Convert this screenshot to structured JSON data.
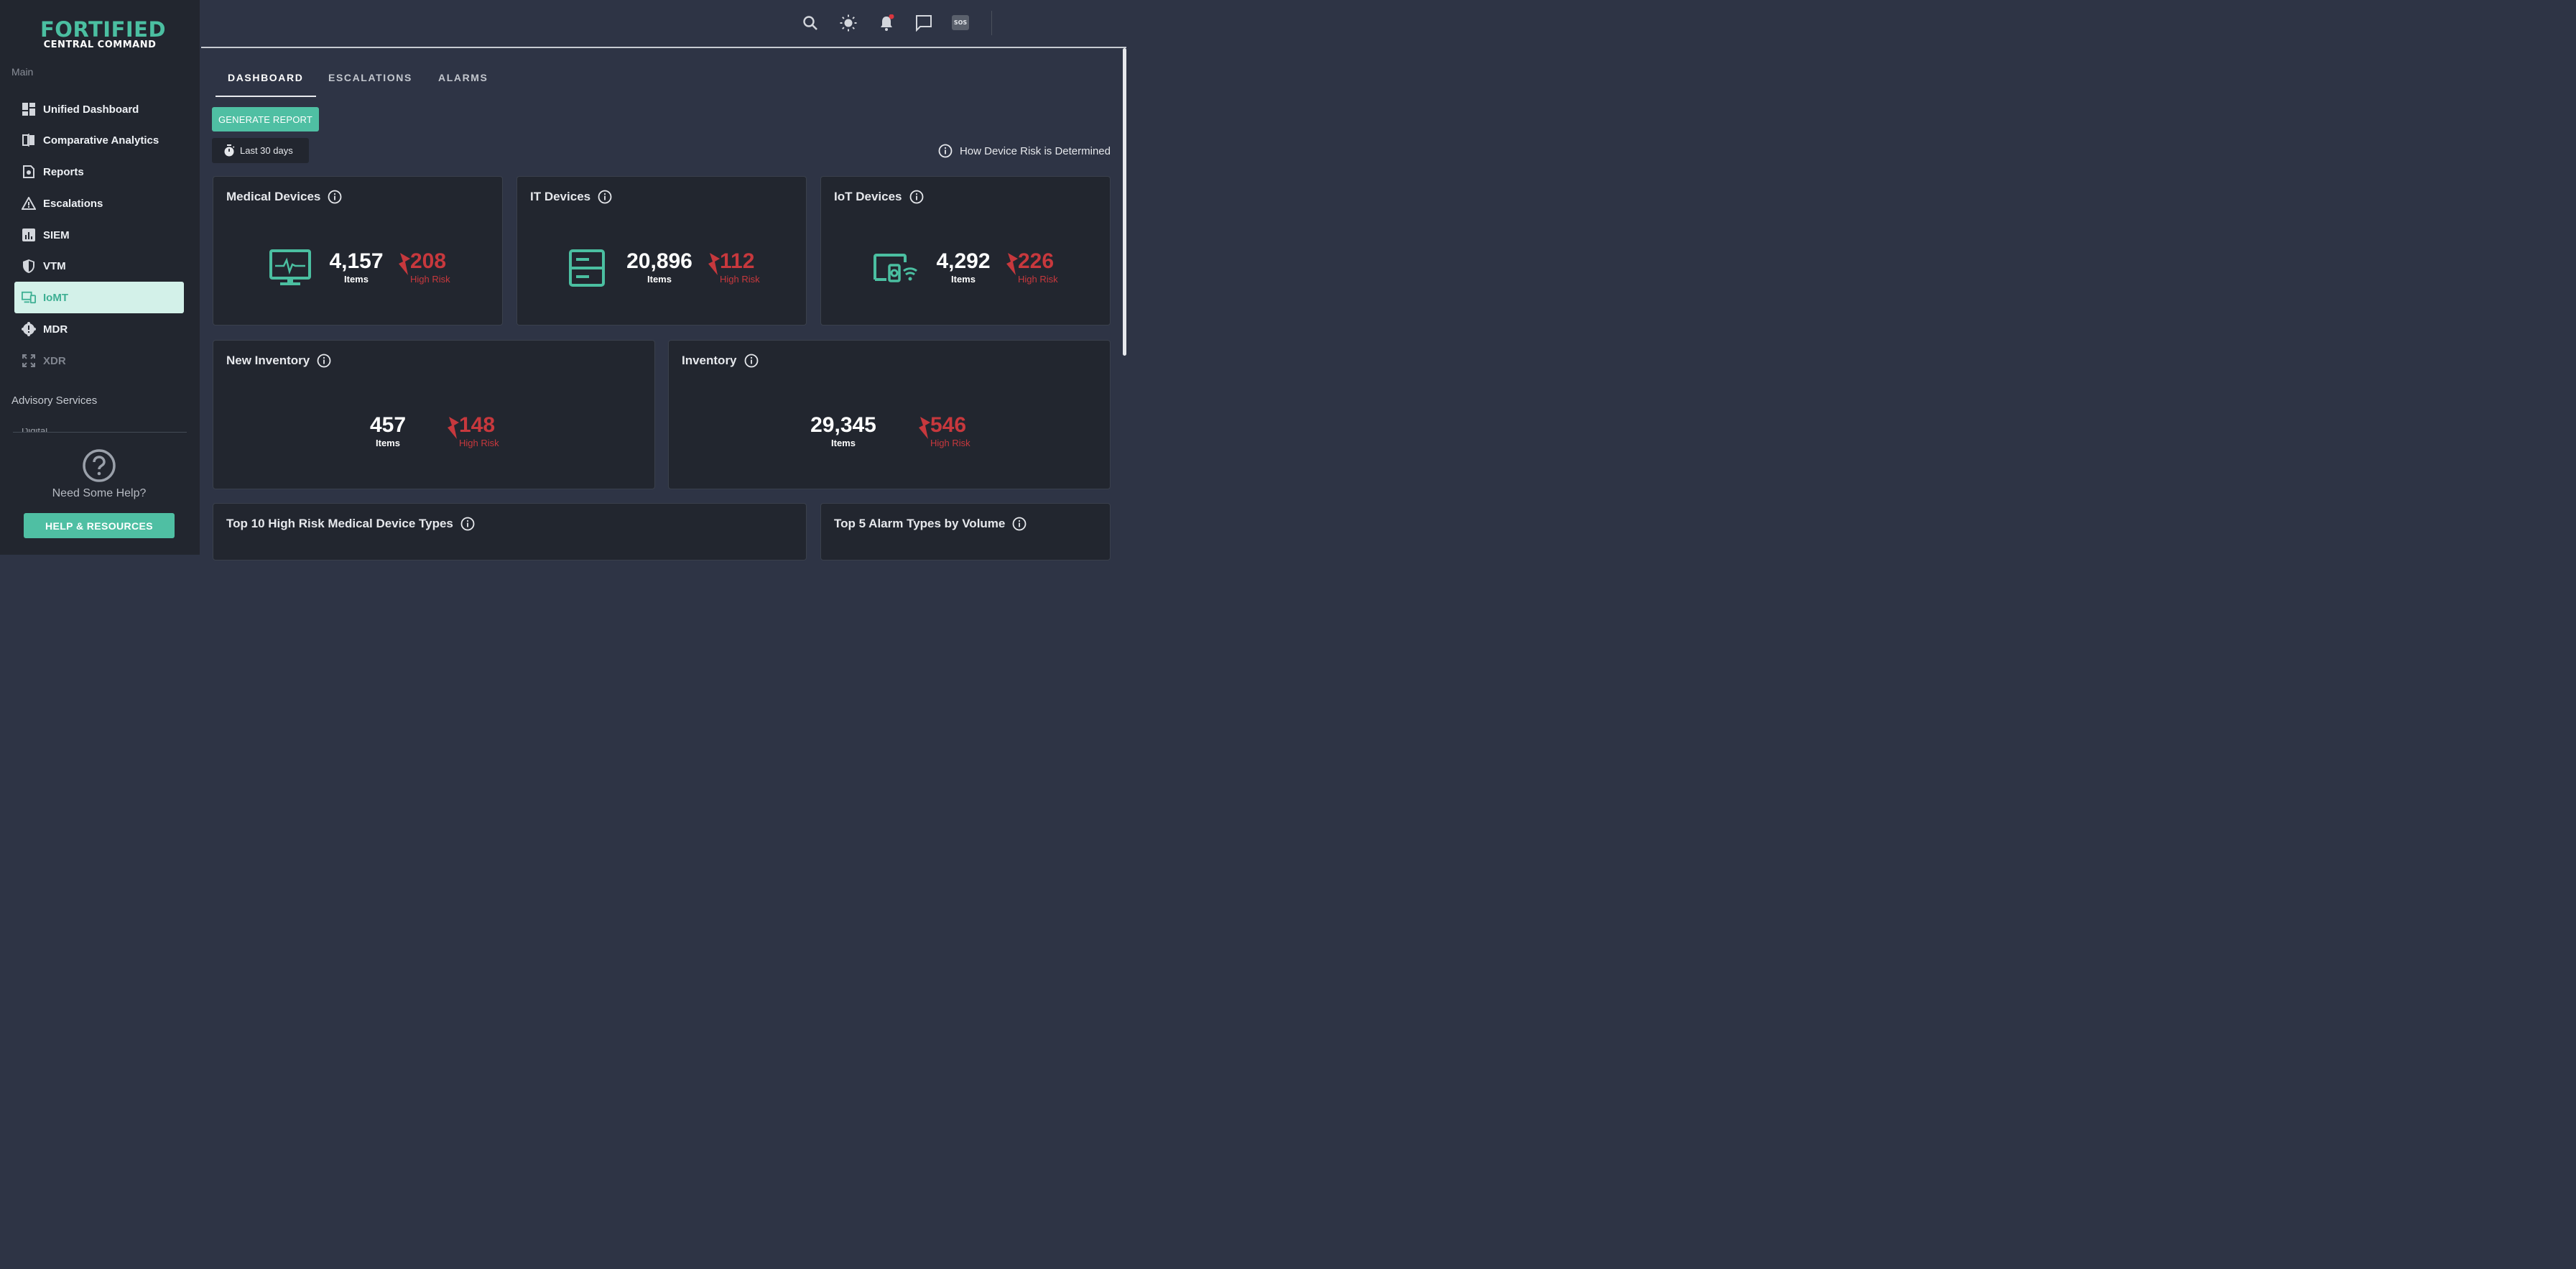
{
  "brand": {
    "line1": "FORTIFIED",
    "line2": "CENTRAL COMMAND"
  },
  "sidebar": {
    "section_main": "Main",
    "items": [
      {
        "label": "Unified Dashboard",
        "icon": "dashboard-grid-icon"
      },
      {
        "label": "Comparative Analytics",
        "icon": "compare-icon"
      },
      {
        "label": "Reports",
        "icon": "report-icon"
      },
      {
        "label": "Escalations",
        "icon": "warning-triangle-icon"
      },
      {
        "label": "SIEM",
        "icon": "bar-chart-icon"
      },
      {
        "label": "VTM",
        "icon": "shield-icon"
      },
      {
        "label": "IoMT",
        "icon": "devices-icon",
        "active": true
      },
      {
        "label": "MDR",
        "icon": "gear-badge-icon"
      },
      {
        "label": "XDR",
        "icon": "expand-icon",
        "disabled": true
      }
    ],
    "section_advisory": "Advisory Services",
    "advisory_partial": "Digital",
    "help_text": "Need Some Help?",
    "help_button": "HELP & RESOURCES"
  },
  "topbar": {
    "icons": [
      "search-icon",
      "brightness-icon",
      "bell-icon",
      "chat-icon",
      "sos-icon"
    ],
    "sos_label": "SOS"
  },
  "tabs": [
    {
      "label": "DASHBOARD",
      "active": true
    },
    {
      "label": "ESCALATIONS"
    },
    {
      "label": "ALARMS"
    }
  ],
  "actions": {
    "generate_report": "GENERATE REPORT",
    "date_filter": "Last 30 days",
    "risk_info": "How Device Risk is Determined"
  },
  "cards": {
    "medical": {
      "title": "Medical Devices",
      "items": "4,157",
      "items_label": "Items",
      "high_risk": "208",
      "high_risk_label": "High Risk"
    },
    "it": {
      "title": "IT Devices",
      "items": "20,896",
      "items_label": "Items",
      "high_risk": "112",
      "high_risk_label": "High Risk"
    },
    "iot": {
      "title": "IoT Devices",
      "items": "4,292",
      "items_label": "Items",
      "high_risk": "226",
      "high_risk_label": "High Risk"
    },
    "new_inventory": {
      "title": "New Inventory",
      "items": "457",
      "items_label": "Items",
      "high_risk": "148",
      "high_risk_label": "High Risk"
    },
    "inventory": {
      "title": "Inventory",
      "items": "29,345",
      "items_label": "Items",
      "high_risk": "546",
      "high_risk_label": "High Risk"
    },
    "top10": {
      "title": "Top 10 High Risk Medical Device Types"
    },
    "top5": {
      "title": "Top 5 Alarm Types by Volume"
    }
  },
  "colors": {
    "accent": "#4fbfa3",
    "risk": "#c7383d",
    "panel": "#22262f",
    "background": "#2e3445",
    "notification": "#d9363e"
  }
}
